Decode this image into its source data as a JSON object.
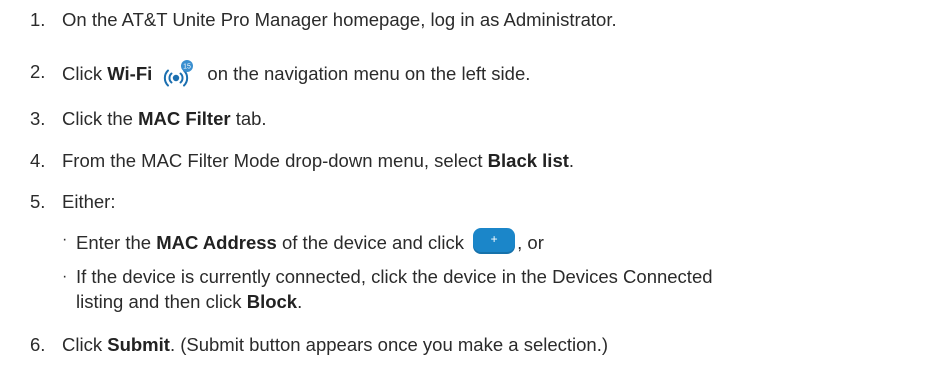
{
  "steps": [
    {
      "num": "1.",
      "parts": [
        "On the AT&T Unite Pro Manager homepage, log in as Administrator."
      ]
    },
    {
      "num": "2.",
      "pre": "Click ",
      "bold": "Wi-Fi",
      "post": " on the navigation menu on the left side.",
      "icon": "wifi-icon"
    },
    {
      "num": "3.",
      "pre": "Click the ",
      "bold": "MAC Filter",
      "post": " tab."
    },
    {
      "num": "4.",
      "pre": "From the MAC Filter Mode drop-down menu, select ",
      "bold": "Black list",
      "post": "."
    },
    {
      "num": "5.",
      "text": "Either:"
    },
    {
      "num": "6.",
      "pre": "Click ",
      "bold": "Submit",
      "post": ". (Submit button appears once you make a selection.)"
    }
  ],
  "wifi_badge": "15",
  "sub_items": [
    {
      "bullet": "·",
      "pre": "Enter the ",
      "bold": "MAC Address",
      "mid": " of the device and click ",
      "post": ", or",
      "button_label": "+"
    },
    {
      "bullet": "·",
      "line1": "If the device is currently connected, click the device in the Devices Connected",
      "line2_pre": "listing and then click ",
      "line2_bold": "Block",
      "line2_post": "."
    }
  ],
  "colors": {
    "text": "#2b2b2b",
    "accent": "#1b86c9",
    "badge": "#3a8fd0"
  }
}
